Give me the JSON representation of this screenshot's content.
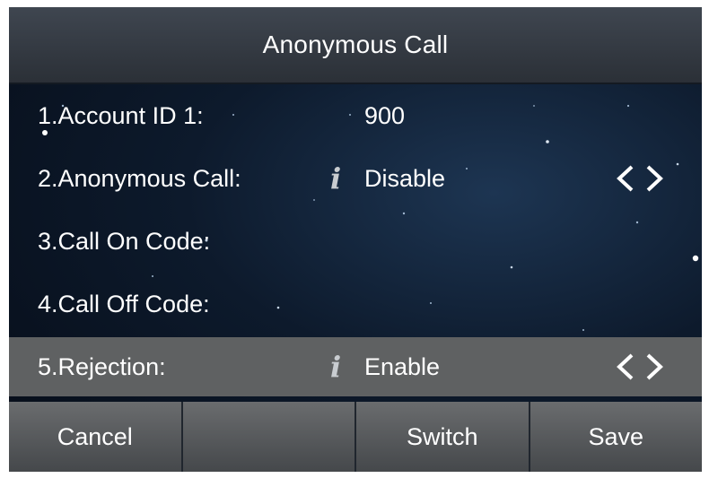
{
  "header": {
    "title": "Anonymous Call"
  },
  "rows": [
    {
      "label": "1.Account ID 1:",
      "value": "900",
      "info": false,
      "arrows": false
    },
    {
      "label": "2.Anonymous Call:",
      "value": "Disable",
      "info_glyph": "i",
      "arrows": true
    },
    {
      "label": "3.Call On Code:",
      "value": ""
    },
    {
      "label": "4.Call Off Code:",
      "value": ""
    },
    {
      "label": "5.Rejection:",
      "value": "Enable",
      "info_glyph": "i",
      "arrows": true,
      "selected": true
    }
  ],
  "softkeys": [
    {
      "label": "Cancel"
    },
    {
      "label": ""
    },
    {
      "label": "Switch"
    },
    {
      "label": "Save"
    }
  ],
  "icons": {
    "info": "info-icon",
    "left": "chevron-left-icon",
    "right": "chevron-right-icon"
  },
  "colors": {
    "selected_row": "#5f6162",
    "text": "#ffffff",
    "titlebar": "#3f4650"
  }
}
